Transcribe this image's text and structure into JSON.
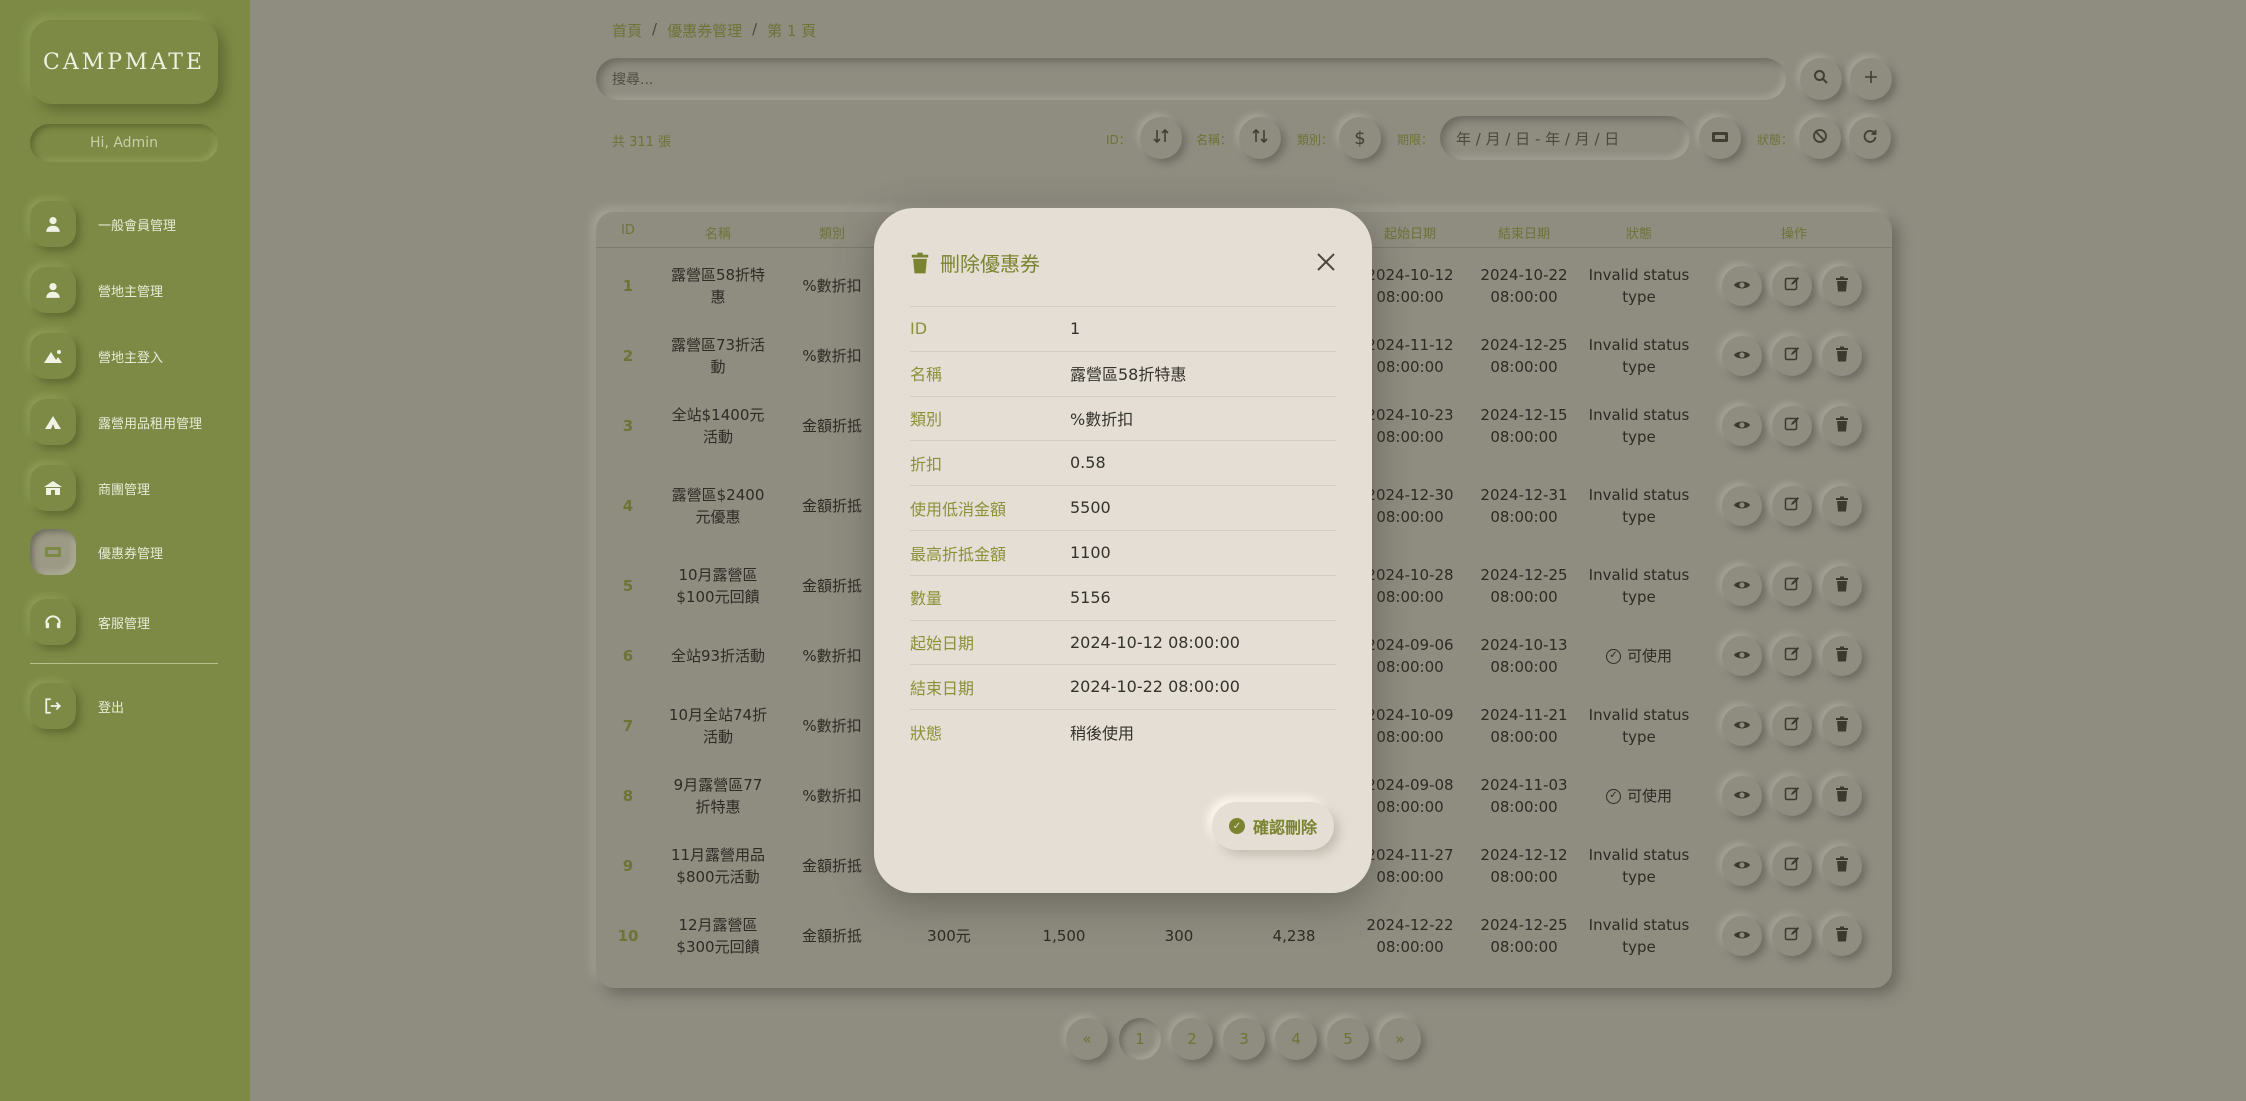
{
  "sidebar": {
    "logo": "CAMPMATE",
    "greeting": "Hi, Admin",
    "items": [
      {
        "label": "一般會員管理",
        "icon": "user-icon"
      },
      {
        "label": "營地主管理",
        "icon": "user-icon"
      },
      {
        "label": "營地主登入",
        "icon": "campsite-icon"
      },
      {
        "label": "露營用品租用管理",
        "icon": "tent-icon"
      },
      {
        "label": "商團管理",
        "icon": "store-icon"
      },
      {
        "label": "優惠券管理",
        "icon": "ticket-icon"
      },
      {
        "label": "客服管理",
        "icon": "headset-icon"
      }
    ],
    "logout": "登出"
  },
  "breadcrumb": [
    "首頁",
    "優惠券管理",
    "第 1 頁"
  ],
  "search": {
    "placeholder": "搜尋..."
  },
  "toolbar": {
    "count": "共 311 張",
    "filters": {
      "id": "ID：",
      "name": "名稱：",
      "type": "類別：",
      "period": "期限：",
      "status": "狀態："
    },
    "date_range": "年 / 月 / 日 - 年 / 月 / 日"
  },
  "table": {
    "headers": {
      "id": "ID",
      "name": "名稱",
      "type": "類別",
      "start": "起始日期",
      "end": "結束日期",
      "status": "狀態",
      "actions": "操作"
    },
    "rows": [
      {
        "id": "1",
        "name": "露營區58折特惠",
        "type": "%數折扣",
        "start_d": "2024-10-12",
        "start_t": "08:00:00",
        "end_d": "2024-10-22",
        "end_t": "08:00:00",
        "status": "Invalid status type"
      },
      {
        "id": "2",
        "name": "露營區73折活動",
        "type": "%數折扣",
        "start_d": "2024-11-12",
        "start_t": "08:00:00",
        "end_d": "2024-12-25",
        "end_t": "08:00:00",
        "status": "Invalid status type"
      },
      {
        "id": "3",
        "name": "全站$1400元活動",
        "type": "金額折抵",
        "start_d": "2024-10-23",
        "start_t": "08:00:00",
        "end_d": "2024-12-15",
        "end_t": "08:00:00",
        "status": "Invalid status type"
      },
      {
        "id": "4",
        "name": "露營區$2400元優惠",
        "type": "金額折抵",
        "start_d": "2024-12-30",
        "start_t": "08:00:00",
        "end_d": "2024-12-31",
        "end_t": "08:00:00",
        "status": "Invalid status type"
      },
      {
        "id": "5",
        "name": "10月露營區$100元回饋",
        "type": "金額折抵",
        "start_d": "2024-10-28",
        "start_t": "08:00:00",
        "end_d": "2024-12-25",
        "end_t": "08:00:00",
        "status": "Invalid status type"
      },
      {
        "id": "6",
        "name": "全站93折活動",
        "type": "%數折扣",
        "start_d": "2024-09-06",
        "start_t": "08:00:00",
        "end_d": "2024-10-13",
        "end_t": "08:00:00",
        "status": "可使用"
      },
      {
        "id": "7",
        "name": "10月全站74折活動",
        "type": "%數折扣",
        "start_d": "2024-10-09",
        "start_t": "08:00:00",
        "end_d": "2024-11-21",
        "end_t": "08:00:00",
        "status": "Invalid status type"
      },
      {
        "id": "8",
        "name": "9月露營區77折特惠",
        "type": "%數折扣",
        "start_d": "2024-09-08",
        "start_t": "08:00:00",
        "end_d": "2024-11-03",
        "end_t": "08:00:00",
        "status": "可使用"
      },
      {
        "id": "9",
        "name": "11月露營用品$800元活動",
        "type": "金額折抵",
        "start_d": "2024-11-27",
        "start_t": "08:00:00",
        "end_d": "2024-12-12",
        "end_t": "08:00:00",
        "status": "Invalid status type"
      },
      {
        "id": "10",
        "name": "12月露營區$300元回饋",
        "type": "金額折抵",
        "discount": "300元",
        "min": "1,500",
        "max": "300",
        "qty": "4,238",
        "start_d": "2024-12-22",
        "start_t": "08:00:00",
        "end_d": "2024-12-25",
        "end_t": "08:00:00",
        "status": "Invalid status type"
      }
    ]
  },
  "pagination": [
    "«",
    "1",
    "2",
    "3",
    "4",
    "5",
    "»"
  ],
  "modal": {
    "title": "刪除優惠券",
    "fields": [
      {
        "label": "ID",
        "value": "1"
      },
      {
        "label": "名稱",
        "value": "露營區58折特惠"
      },
      {
        "label": "類別",
        "value": "%數折扣"
      },
      {
        "label": "折扣",
        "value": "0.58"
      },
      {
        "label": "使用低消金額",
        "value": "5500"
      },
      {
        "label": "最高折抵金額",
        "value": "1100"
      },
      {
        "label": "數量",
        "value": "5156"
      },
      {
        "label": "起始日期",
        "value": "2024-10-12 08:00:00"
      },
      {
        "label": "結束日期",
        "value": "2024-10-22 08:00:00"
      },
      {
        "label": "狀態",
        "value": "稍後使用"
      }
    ],
    "confirm": "確認刪除"
  },
  "colors": {
    "sidebar": "#7c8a45",
    "overlay": "#8f8c80",
    "modal": "#e5ded4",
    "accent": "#7a8430"
  }
}
